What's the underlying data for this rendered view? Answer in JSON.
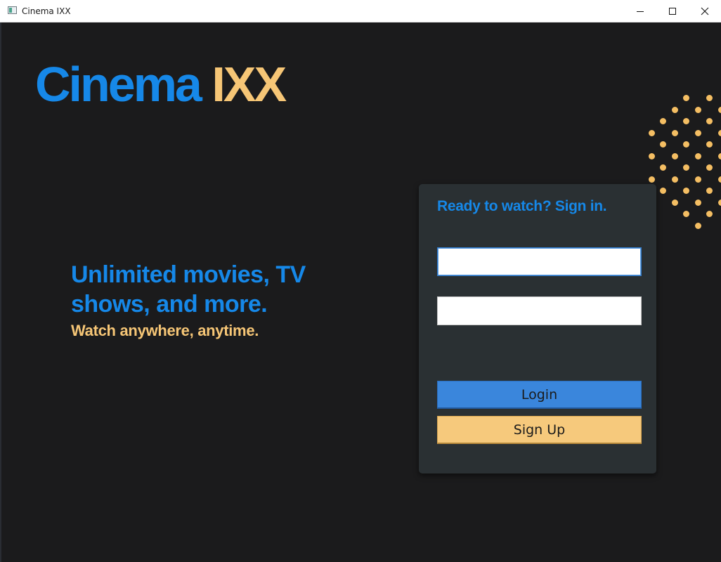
{
  "window": {
    "title": "Cinema IXX",
    "controls": [
      "minimize",
      "maximize",
      "close"
    ]
  },
  "brand": {
    "word1": "Cinema",
    "word2": "IXX",
    "colors": {
      "primary": "#1688e8",
      "accent": "#f6c676"
    }
  },
  "hero": {
    "headline": "Unlimited movies, TV shows, and more.",
    "subline": "Watch anywhere, anytime."
  },
  "login_card": {
    "title": "Ready to watch? Sign in.",
    "username_value": "",
    "password_value": "",
    "login_label": "Login",
    "signup_label": "Sign Up"
  },
  "decoration": {
    "dot_color": "#f4be63"
  },
  "theme": {
    "background": "#1b1b1c",
    "card_background": "#2a3033",
    "login_button": "#3a86dc",
    "signup_button": "#f6c97c"
  }
}
